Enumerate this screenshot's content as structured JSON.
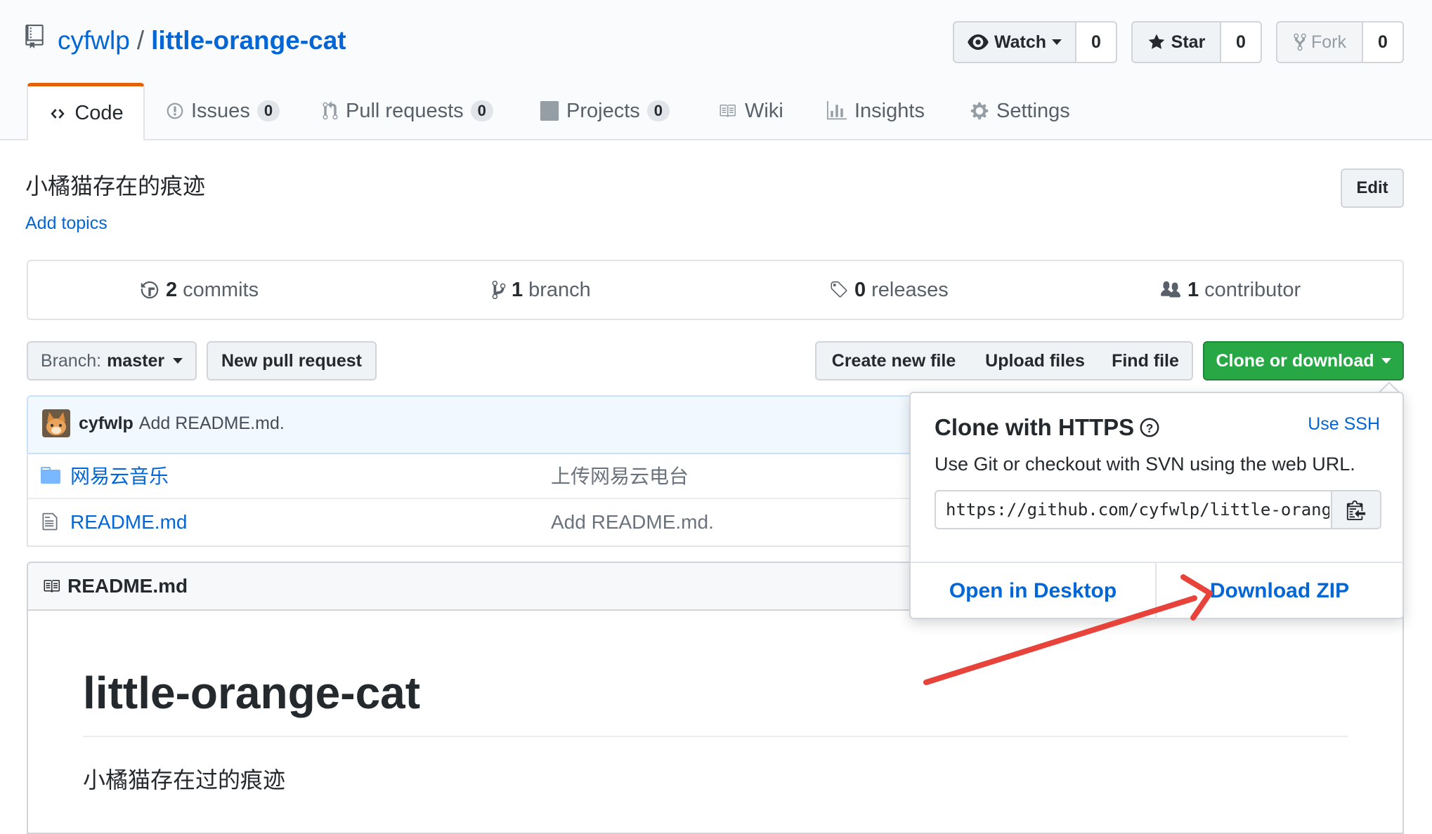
{
  "repo": {
    "owner": "cyfwlp",
    "separator": "/",
    "name": "little-orange-cat"
  },
  "social": {
    "watch": {
      "label": "Watch",
      "count": "0"
    },
    "star": {
      "label": "Star",
      "count": "0"
    },
    "fork": {
      "label": "Fork",
      "count": "0"
    }
  },
  "tabs": [
    {
      "label": "Code"
    },
    {
      "label": "Issues",
      "count": "0"
    },
    {
      "label": "Pull requests",
      "count": "0"
    },
    {
      "label": "Projects",
      "count": "0"
    },
    {
      "label": "Wiki"
    },
    {
      "label": "Insights"
    },
    {
      "label": "Settings"
    }
  ],
  "description": {
    "text": "小橘猫存在的痕迹",
    "add_topics": "Add topics",
    "edit": "Edit"
  },
  "summary": {
    "commits": {
      "num": "2",
      "label": "commits"
    },
    "branch": {
      "num": "1",
      "label": "branch"
    },
    "releases": {
      "num": "0",
      "label": "releases"
    },
    "contributor": {
      "num": "1",
      "label": "contributor"
    }
  },
  "file_nav": {
    "branch_label": "Branch:",
    "branch_name": "master",
    "new_pr": "New pull request",
    "create_file": "Create new file",
    "upload_files": "Upload files",
    "find_file": "Find file",
    "clone": "Clone or download"
  },
  "commit": {
    "author": "cyfwlp",
    "message": "Add README.md."
  },
  "files": [
    {
      "name": "网易云音乐",
      "type": "folder",
      "message": "上传网易云电台"
    },
    {
      "name": "README.md",
      "type": "file",
      "message": "Add README.md."
    }
  ],
  "readme": {
    "header": "README.md",
    "h1": "little-orange-cat",
    "p": "小橘猫存在过的痕迹"
  },
  "clone_dropdown": {
    "title": "Clone with HTTPS",
    "use_ssh": "Use SSH",
    "subtitle": "Use Git or checkout with SVN using the web URL.",
    "url": "https://github.com/cyfwlp/little-orange-cat.git",
    "open_desktop": "Open in Desktop",
    "download_zip": "Download ZIP"
  },
  "colors": {
    "link": "#0366d6",
    "green": "#28a745",
    "tab_accent": "#e36209",
    "annotation_arrow": "#e8433a"
  }
}
